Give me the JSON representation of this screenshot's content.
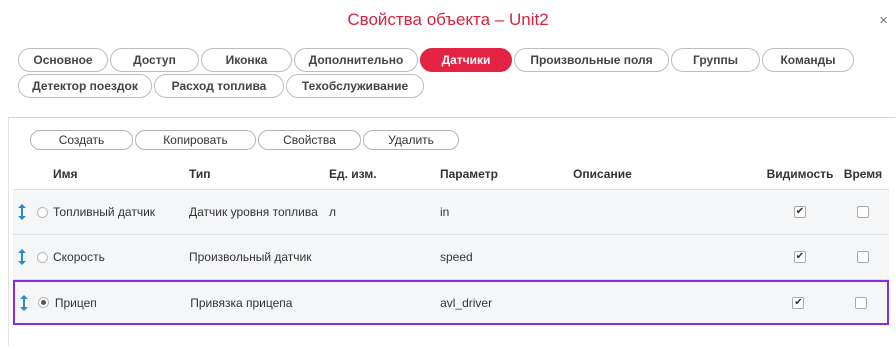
{
  "dialog": {
    "title": "Свойства объекта – Unit2",
    "close": "×"
  },
  "tabs": {
    "row1": [
      {
        "label": "Основное",
        "active": false
      },
      {
        "label": "Доступ",
        "active": false
      },
      {
        "label": "Иконка",
        "active": false
      },
      {
        "label": "Дополнительно",
        "active": false
      },
      {
        "label": "Датчики",
        "active": true
      },
      {
        "label": "Произвольные поля",
        "active": false
      },
      {
        "label": "Группы",
        "active": false
      },
      {
        "label": "Команды",
        "active": false
      }
    ],
    "row2": [
      {
        "label": "Детектор поездок",
        "active": false
      },
      {
        "label": "Расход топлива",
        "active": false
      },
      {
        "label": "Техобслуживание",
        "active": false
      }
    ]
  },
  "actions": {
    "create": "Создать",
    "copy": "Копировать",
    "properties": "Свойства",
    "delete": "Удалить"
  },
  "table": {
    "headers": {
      "name": "Имя",
      "type": "Тип",
      "unit": "Ед. изм.",
      "param": "Параметр",
      "desc": "Описание",
      "visibility": "Видимость",
      "time": "Время"
    },
    "rows": [
      {
        "name": "Топливный датчик",
        "type": "Датчик уровня топлива",
        "unit": "л",
        "param": "in",
        "desc": "",
        "visible": true,
        "time": false,
        "selected": false
      },
      {
        "name": "Скорость",
        "type": "Произвольный датчик",
        "unit": "",
        "param": "speed",
        "desc": "",
        "visible": true,
        "time": false,
        "selected": false
      },
      {
        "name": "Прицеп",
        "type": "Привязка прицепа",
        "unit": "",
        "param": "avl_driver",
        "desc": "",
        "visible": true,
        "time": false,
        "selected": true
      }
    ]
  },
  "colors": {
    "accent": "#e42244",
    "title": "#d8233f",
    "selection": "#8a2be2"
  }
}
